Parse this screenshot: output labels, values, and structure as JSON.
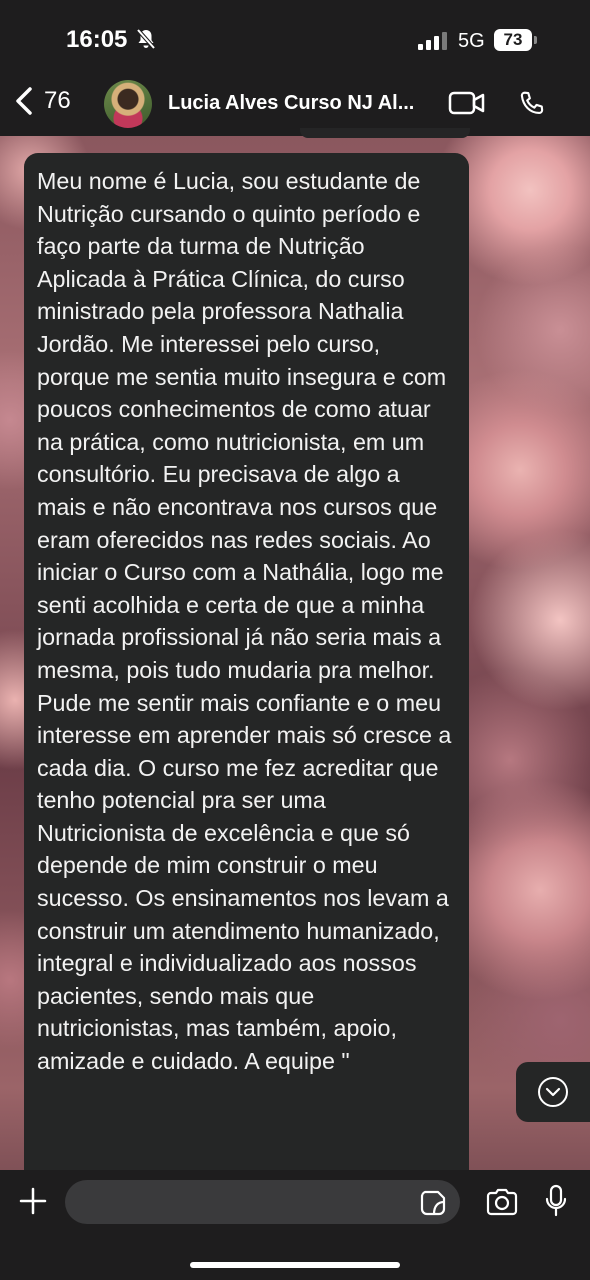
{
  "status_bar": {
    "time": "16:05",
    "network": "5G",
    "battery": "73"
  },
  "header": {
    "back_count": "76",
    "contact_name": "Lucia Alves Curso NJ Al..."
  },
  "message": {
    "text": "Meu nome é Lucia, sou estudante de Nutrição cursando o quinto período e faço parte da turma de Nutrição Aplicada à Prática Clínica, do curso ministrado pela professora Nathalia Jordão. Me interessei pelo curso, porque me sentia muito insegura e com poucos conhecimentos de como atuar na prática, como nutricionista, em um consultório. Eu precisava de algo a mais e não encontrava nos cursos que eram oferecidos nas redes sociais. Ao iniciar o Curso com a Nathália, logo me senti acolhida e certa de que a minha jornada profissional já não seria mais a mesma, pois tudo mudaria pra melhor. Pude me sentir mais confiante e o meu interesse em aprender mais só cresce a cada dia. O curso me fez acreditar que tenho potencial pra ser uma Nutricionista de excelência e que só depende de mim construir o meu sucesso. Os ensinamentos nos levam a construir um atendimento humanizado, integral e individualizado aos nossos pacientes, sendo mais que nutricionistas, mas também, apoio, amizade e cuidado. A equipe \""
  },
  "composer": {
    "placeholder": ""
  },
  "icons": {
    "status": [
      "bell-muted-icon",
      "signal-icon",
      "battery-icon"
    ],
    "header": [
      "back-chevron-icon",
      "video-call-icon",
      "phone-call-icon"
    ],
    "composer": [
      "plus-icon",
      "sticker-icon",
      "camera-icon",
      "microphone-icon"
    ],
    "scroll": "chevron-down-circle-icon"
  },
  "colors": {
    "bar": "#1e1d1e",
    "bubble": "#252626",
    "input": "#3a3a3c",
    "text": "#f2f2f2"
  }
}
